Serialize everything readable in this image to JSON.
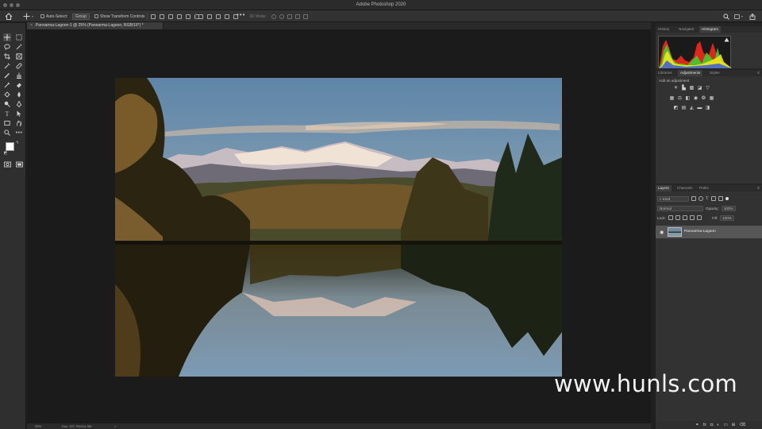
{
  "window": {
    "app_title": "Adobe Photoshop 2020"
  },
  "options_bar": {
    "auto_select_label": "Auto-Select:",
    "auto_select_target": "Group",
    "show_transform_label": "Show Transform Controls",
    "mode_3d_label": "3D Mode:"
  },
  "document_tab": {
    "title": "Panoarma-Lagoon-1 @ 25% (Panoarma-Lagoon, RGB/16*) *",
    "close_glyph": "×"
  },
  "status_bar": {
    "zoom": "25%",
    "doc_info": "Doc: 207.7M/414.3M",
    "arrow": ">"
  },
  "panels": {
    "top_tabs": [
      "History",
      "Navigator",
      "Histogram"
    ],
    "top_active": "Histogram",
    "mid_tabs": [
      "Libraries",
      "Adjustments",
      "Styles"
    ],
    "mid_active": "Adjustments",
    "add_adjustment_label": "Add an adjustment",
    "layers_tabs": [
      "Layers",
      "Channels",
      "Paths"
    ],
    "layers_active": "Layers",
    "kind_label": "Kind",
    "blend_mode": "Normal",
    "opacity_label": "Opacity:",
    "opacity_value": "100%",
    "lock_label": "Lock:",
    "fill_label": "Fill:",
    "fill_value": "100%",
    "layer_name": "Panoarma-Lagoon"
  },
  "watermark": {
    "text": "www.hunls.com"
  },
  "colors": {
    "accent": "#3e3e3e",
    "histogram_red": "#e8281e",
    "histogram_green": "#3ecf2f",
    "histogram_yellow": "#f2e51c",
    "histogram_blue": "#3a5bd9"
  }
}
